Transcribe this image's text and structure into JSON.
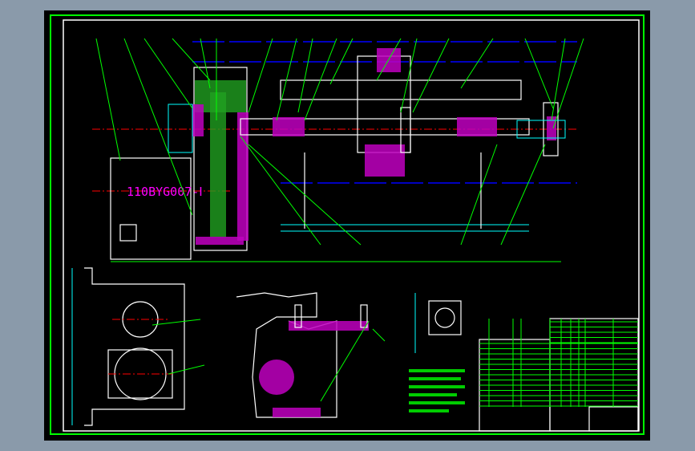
{
  "drawing": {
    "motor_label": "110BYG007-Ⅰ",
    "colors": {
      "background": "#8a9aaa",
      "sheet": "#000000",
      "frame": "#00ff00",
      "outline": "#ffffff",
      "centerline": "#ff0000",
      "hidden": "#0000ff",
      "section_hatch": "#c000c0",
      "dimension": "#00ffff",
      "label": "#ff00ff"
    }
  }
}
